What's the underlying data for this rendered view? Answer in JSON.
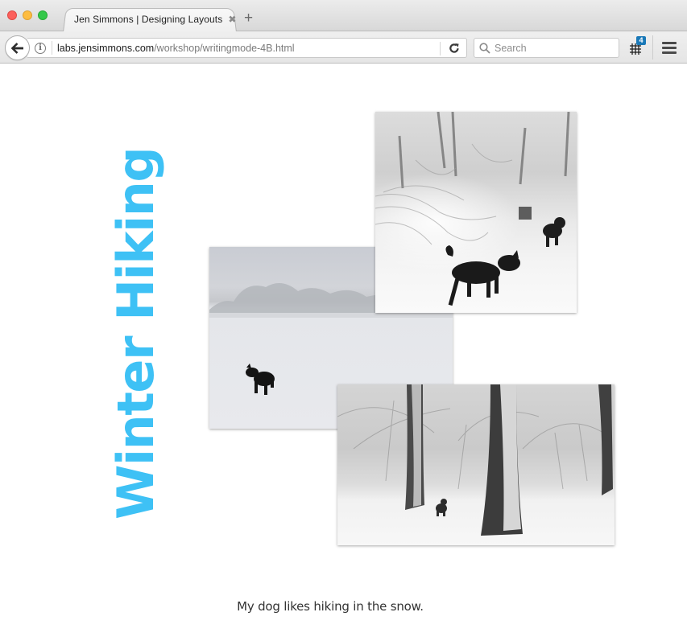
{
  "browser": {
    "tab": {
      "title": "Jen Simmons | Designing Layouts",
      "close_glyph": "✖"
    },
    "new_tab_glyph": "+",
    "url": {
      "domain": "labs.jensimmons.com",
      "path": "/workshop/writingmode-4B.html"
    },
    "search": {
      "placeholder": "Search",
      "value": ""
    },
    "grid_badge_count": "4",
    "icons": {
      "back": "arrow-left-icon",
      "info": "info-icon",
      "reload": "reload-icon",
      "search": "magnifier-icon",
      "grid": "css-grid-icon",
      "menu": "hamburger-icon"
    }
  },
  "page": {
    "heading": "Winter Hiking",
    "heading_color": "#3ec1f5",
    "caption": "My dog likes hiking in the snow.",
    "photos": [
      {
        "alt": "Two black dogs on a snowy forest trail"
      },
      {
        "alt": "Black dog standing in a snowy open field"
      },
      {
        "alt": "Dog among tall snow-covered trees"
      }
    ]
  }
}
